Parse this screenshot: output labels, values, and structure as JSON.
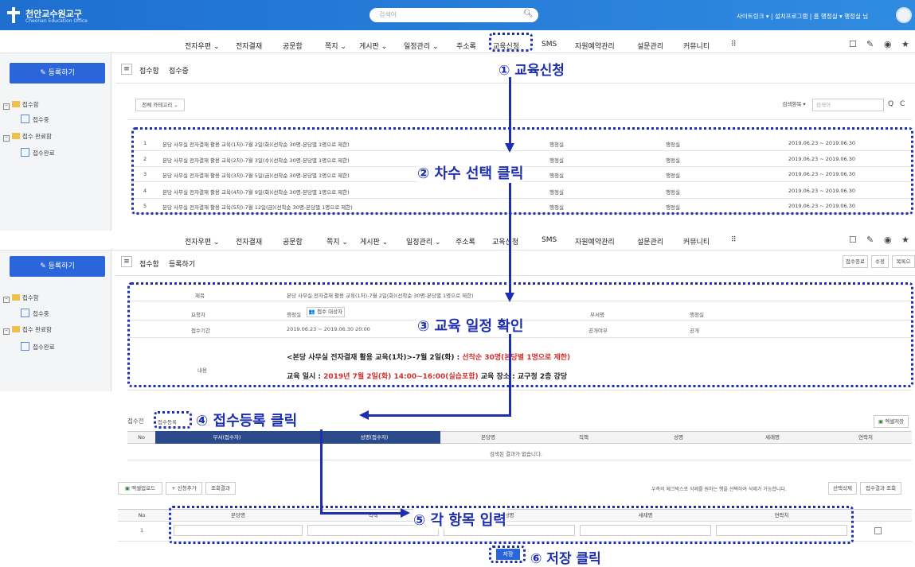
{
  "topbar": {
    "logo_text": "천안교수원교구",
    "logo_sub": "Cheonan Education Office",
    "search_placeholder": "검색어",
    "links": "사이트링크 ▾  |  설치프로그램  |  홈  행정실 ▾  행정실 님"
  },
  "nav": {
    "items": [
      "전자우편 ⌄",
      "전자결재",
      "공문함",
      "쪽지 ⌄",
      "게시판 ⌄",
      "일정관리 ⌄",
      "주소록",
      "교육신청",
      "SMS",
      "자원예약관리",
      "설문관리",
      "커뮤니티",
      "⠿"
    ],
    "items2": [
      "전자우편 ⌄",
      "전자결재",
      "공문함",
      "쪽지 ⌄",
      "게시판 ⌄",
      "일정관리 ⌄",
      "주소록",
      "교육신청",
      "SMS",
      "자원예약관리",
      "설문관리",
      "커뮤니티",
      "⠿"
    ],
    "right_icons": [
      "☐",
      "✎",
      "◉",
      "★"
    ]
  },
  "sidebar": {
    "register_label": "✎ 등록하기",
    "tree": [
      {
        "label": "접수함",
        "type": "folder"
      },
      {
        "label": "접수중",
        "type": "doc"
      },
      {
        "label": "접수 완료함",
        "type": "folder"
      },
      {
        "label": "접수완료",
        "type": "doc"
      }
    ]
  },
  "list_page": {
    "crumb1": "접수함",
    "crumb2": "접수중",
    "category": "전체 카테고리 ⌄",
    "search_field": "검색항목 ▾",
    "search_ph": "검색어",
    "rows": [
      {
        "no": "1",
        "title": "본당 사무실 전자결재 활용 교육(1차)-7월 2일(화)(선착순 30명-본당별 1명으로 제한)",
        "dept": "행정실",
        "writer": "행정실",
        "period": "2019.06.23 ~ 2019.06.30"
      },
      {
        "no": "2",
        "title": "본당 사무실 전자결재 활용 교육(2차)-7월 3일(수)(선착순 30명-본당별 1명으로 제한)",
        "dept": "행정실",
        "writer": "행정실",
        "period": "2019.06.23 ~ 2019.06.30"
      },
      {
        "no": "3",
        "title": "본당 사무실 전자결재 활용 교육(3차)-7월 5일(금)(선착순 30명-본당별 1명으로 제한)",
        "dept": "행정실",
        "writer": "행정실",
        "period": "2019.06.23 ~ 2019.06.30"
      },
      {
        "no": "4",
        "title": "본당 사무실 전자결재 활용 교육(4차)-7월 9일(화)(선착순 30명-본당별 1명으로 제한)",
        "dept": "행정실",
        "writer": "행정실",
        "period": "2019.06.23 ~ 2019.06.30"
      },
      {
        "no": "5",
        "title": "본당 사무실 전자결재 활용 교육(5차)-7월 12일(금)(선착순 30명-본당별 1명으로 제한)",
        "dept": "행정실",
        "writer": "행정실",
        "period": "2019.06.23 ~ 2019.06.30"
      }
    ]
  },
  "detail_page": {
    "crumb1": "접수함",
    "crumb2": "등록하기",
    "top_buttons": [
      "접수종료",
      "수정",
      "목록으"
    ],
    "labels": {
      "title": "제목",
      "requester": "요청자",
      "period": "접수기간",
      "content": "내용",
      "dept": "부서명",
      "public": "공개여부"
    },
    "values": {
      "title": "본당 사무실 전자결재 활용 교육(1차)-7월 2일(화)(선착순 30명-본당별 1명으로 제한)",
      "requester": "행정실",
      "requester_btn": "👥 접수 대상자",
      "period": "2019.06.23 ~ 2019.06.30 20:00",
      "dept": "행정실",
      "public": "공개",
      "content_line1_a": "<본당 사무실 전자결재 활용 교육(1차)>-7월 2일(화) : ",
      "content_line1_b": "선착순 30명(본당별 1명으로 제한)",
      "content_line2_a": "교육 일시 : ",
      "content_line2_b": "2019년 7월 2일(화) 14:00~16:00(실습포함)",
      "content_line2_c": "   교육 장소 : 교구청 2층 강당"
    }
  },
  "reg_section": {
    "label": "접수전",
    "reg_btn": "접수등록",
    "excel_save": "엑셀저장",
    "headers": [
      "No",
      "부서(접수자)",
      "",
      "성명(접수자)",
      "본당명",
      "직책",
      "성명",
      "세례명",
      "연락처"
    ],
    "empty": "검색된 결과가 없습니다."
  },
  "input_section": {
    "buttons": [
      "엑셀업로드",
      "+ 신청추가",
      "조회결과"
    ],
    "hint": "우측의 체크박스로 삭제를 원하는 행을 선택하여 삭제가 가능합니다.",
    "right_buttons": [
      "선택삭제",
      "접수결과 조회"
    ],
    "headers": [
      "No",
      "본당명",
      "직책",
      "성명",
      "세례명",
      "연락처"
    ],
    "row_no": "1",
    "save": "저장"
  },
  "annotations": {
    "a1": "① 교육신청",
    "a2": "② 차수 선택 클릭",
    "a3": "③ 교육 일정 확인",
    "a4": "④ 접수등록 클릭",
    "a5": "⑤ 각 항목 입력",
    "a6": "⑥ 저장 클릭"
  },
  "colors": {
    "accent": "#2a66d9",
    "annotation": "#1d2fb0",
    "header_dark": "#2b4a8c",
    "highlight_red": "#d0312d"
  }
}
